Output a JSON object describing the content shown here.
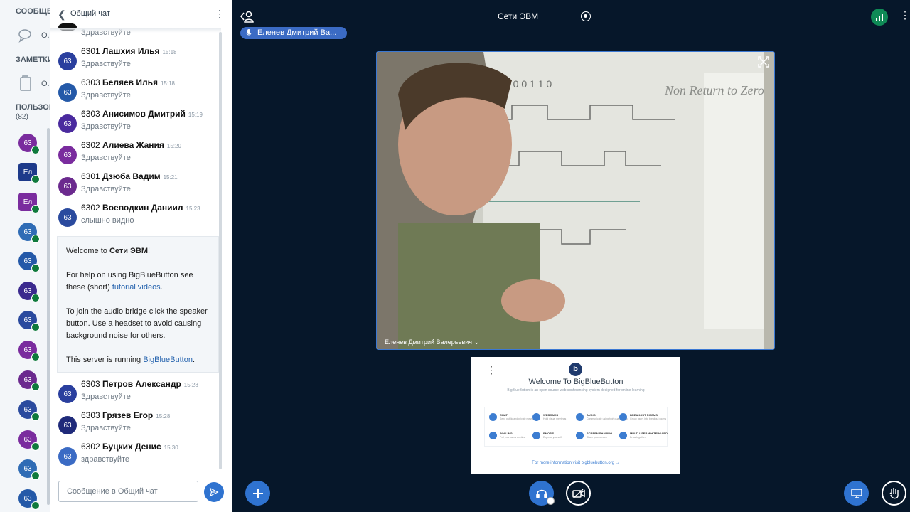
{
  "sidebar": {
    "messages_heading": "СООБЩЕН",
    "public_chat_short": "О.",
    "notes_heading": "ЗАМЕТКИ",
    "shared_notes_short": "О.",
    "users_heading": "ПОЛЬЗОВ",
    "users_count": "(82)",
    "users": [
      {
        "initials": "63",
        "color": "#7A2C9E"
      },
      {
        "initials": "Ел",
        "color": "#1D3A8A"
      },
      {
        "initials": "Ел",
        "color": "#7A2C9E"
      },
      {
        "initials": "63",
        "color": "#2F6CB5"
      },
      {
        "initials": "63",
        "color": "#2459A8"
      },
      {
        "initials": "63",
        "color": "#3B2A8E"
      },
      {
        "initials": "63",
        "color": "#2A4A9E"
      },
      {
        "initials": "63",
        "color": "#7A2C9E"
      },
      {
        "initials": "63",
        "color": "#6B2A8E"
      },
      {
        "initials": "63",
        "color": "#2A4A9E"
      },
      {
        "initials": "63",
        "color": "#7A2C9E"
      },
      {
        "initials": "63",
        "color": "#2F6CB5"
      },
      {
        "initials": "63",
        "color": "#2459A8"
      }
    ]
  },
  "chat": {
    "title": "Общий чат",
    "partial_message": "Здравствуйте",
    "messages": [
      {
        "avatar": "63",
        "color": "#2A3F9E",
        "group": "6301",
        "name": "Лашхия Илья",
        "time": "15:18",
        "text": "Здравствуйте"
      },
      {
        "avatar": "63",
        "color": "#2459A8",
        "group": "6303",
        "name": "Беляев Илья",
        "time": "15:18",
        "text": "Здравствуйте"
      },
      {
        "avatar": "63",
        "color": "#4A2A9E",
        "group": "6303",
        "name": "Анисимов Дмитрий",
        "time": "15:19",
        "text": "Здравствуйте"
      },
      {
        "avatar": "63",
        "color": "#7A2C9E",
        "group": "6302",
        "name": "Алиева Жания",
        "time": "15:20",
        "text": "Здравствуйте"
      },
      {
        "avatar": "63",
        "color": "#6B2A8E",
        "group": "6301",
        "name": "Дзюба Вадим",
        "time": "15:21",
        "text": "Здравствуйте"
      },
      {
        "avatar": "63",
        "color": "#2A4A9E",
        "group": "6302",
        "name": "Воеводкин Даниил",
        "time": "15:23",
        "text": "слышно видно"
      },
      {
        "avatar": "63",
        "color": "#2A3F9E",
        "group": "6303",
        "name": "Петров Александр",
        "time": "15:28",
        "text": "Здравствуйте"
      },
      {
        "avatar": "63",
        "color": "#1F2A7A",
        "group": "6303",
        "name": "Грязев Егор",
        "time": "15:28",
        "text": "Здравствуйте"
      },
      {
        "avatar": "63",
        "color": "#3B6BC4",
        "group": "6302",
        "name": "Буцких Денис",
        "time": "15:30",
        "text": "здравствуйте"
      }
    ],
    "welcome": {
      "line1_prefix": "Welcome to ",
      "line1_bold": "Сети ЭВМ",
      "line1_suffix": "!",
      "line2_a": "For help on using BigBlueButton see these (short) ",
      "line2_link": "tutorial videos",
      "line2_b": ".",
      "line3": "To join the audio bridge click the speaker button. Use a headset to avoid causing background noise for others.",
      "line4_a": "This server is running ",
      "line4_link": "BigBlueButton",
      "line4_b": "."
    },
    "input_placeholder": "Сообщение в Общий чат"
  },
  "header": {
    "meeting_title": "Сети ЭВМ",
    "talker": "Еленев Дмитрий Ва..."
  },
  "video": {
    "presenter_name": "Еленев Дмитрий Валерьевич ⌄",
    "board_text": "Non Return to Zero"
  },
  "presentation": {
    "logo": "b",
    "title": "Welcome To BigBlueButton",
    "subtitle": "BigBlueButton is an open source web conferencing system designed for online learning",
    "features": [
      {
        "label": "CHAT",
        "desc": "Send public and private messages"
      },
      {
        "label": "WEBCAMS",
        "desc": "Hold visual meetings"
      },
      {
        "label": "AUDIO",
        "desc": "Communicate using high quality audio"
      },
      {
        "label": "BREAKOUT ROOMS",
        "desc": "Group users into breakout rooms"
      },
      {
        "label": "POLLING",
        "desc": "Poll your users anytime"
      },
      {
        "label": "EMOJIS",
        "desc": "Express yourself"
      },
      {
        "label": "SCREEN SHARING",
        "desc": "Share your screen"
      },
      {
        "label": "MULTI-USER WHITEBOARD",
        "desc": "Draw together"
      }
    ],
    "footer": "For more information visit bigbluebutton.org →"
  },
  "colors": {
    "background": "#06172A",
    "accent": "#2F73D0",
    "connection": "#0F8A56"
  }
}
